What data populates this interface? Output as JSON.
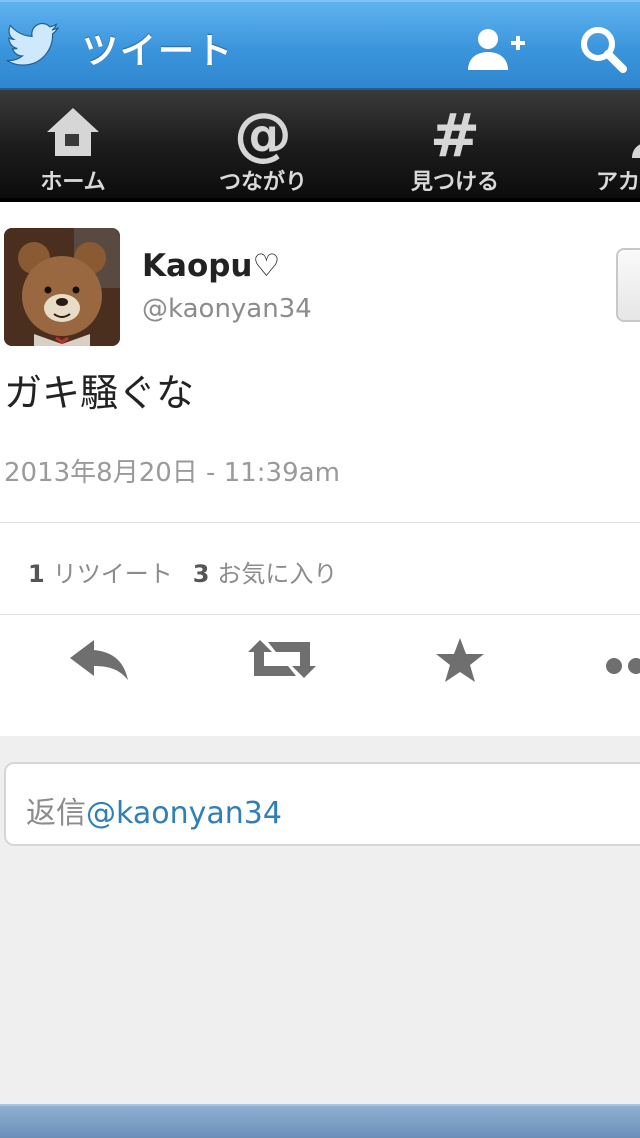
{
  "header": {
    "title": "ツイート",
    "icons": [
      "twitter-bird-icon",
      "add-user-icon",
      "search-icon"
    ]
  },
  "tabs": [
    {
      "label": "ホーム",
      "icon": "home-icon"
    },
    {
      "label": "つながり",
      "icon": "at-sign-icon"
    },
    {
      "label": "見つける",
      "icon": "hashtag-icon"
    },
    {
      "label": "アカ",
      "icon": "account-icon"
    }
  ],
  "tweet": {
    "display_name": "Kaopu♡",
    "handle": "@kaonyan34",
    "text": "ガキ騒ぐな",
    "timestamp": "2013年8月20日 - 11:39am",
    "retweet_count": "1",
    "retweet_label": "リツイート",
    "favorite_count": "3",
    "favorite_label": "お気に入り"
  },
  "reply": {
    "prefix": "返信",
    "mention": "@kaonyan34"
  },
  "colors": {
    "header_blue": "#3b95dc",
    "tabbar_black": "#1d1d1d",
    "mention_blue": "#2f80b8"
  }
}
